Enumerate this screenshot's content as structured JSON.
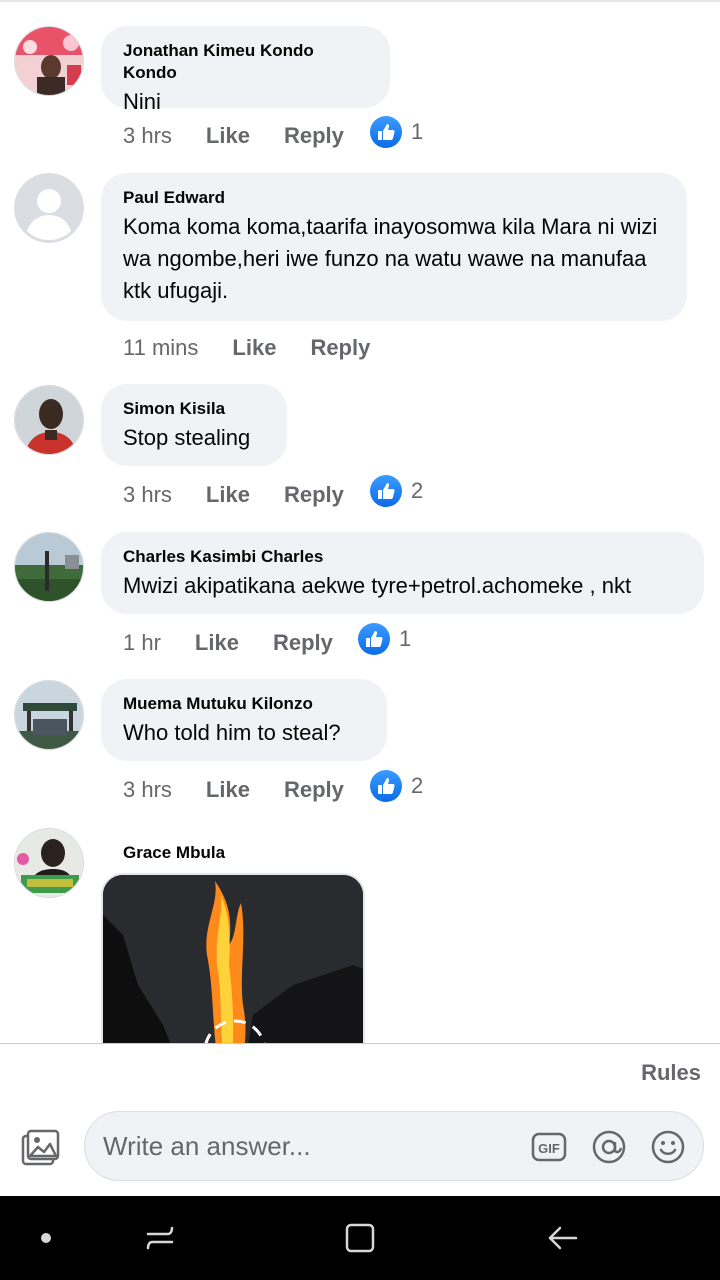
{
  "comments": [
    {
      "author": "Jonathan Kimeu Kondo Kondo",
      "text": "Nini",
      "time": "3 hrs",
      "like_label": "Like",
      "reply_label": "Reply",
      "reaction_count": "1",
      "avatar": "profile-photo-colorful"
    },
    {
      "author": "Paul Edward",
      "text": "Koma koma koma,taarifa inayosomwa kila Mara ni wizi wa ngombe,heri iwe funzo na watu wawe na manufaa ktk ufugaji.",
      "time": "11 mins",
      "like_label": "Like",
      "reply_label": "Reply",
      "reaction_count": "",
      "avatar": "default-user-icon"
    },
    {
      "author": "Simon Kisila",
      "text": "Stop stealing",
      "time": "3 hrs",
      "like_label": "Like",
      "reply_label": "Reply",
      "reaction_count": "2",
      "avatar": "profile-photo-man-red-shirt"
    },
    {
      "author": "Charles Kasimbi Charles",
      "text": "Mwizi akipatikana aekwe tyre+petrol.achomeke , nkt",
      "time": "1 hr",
      "like_label": "Like",
      "reply_label": "Reply",
      "reaction_count": "1",
      "avatar": "profile-photo-outdoor-green"
    },
    {
      "author": "Muema Mutuku Kilonzo",
      "text": "Who told him to steal?",
      "time": "3 hrs",
      "like_label": "Like",
      "reply_label": "Reply",
      "reaction_count": "2",
      "avatar": "profile-photo-structure"
    },
    {
      "author": "Grace Mbula",
      "text": "",
      "time": "",
      "like_label": "",
      "reply_label": "",
      "reaction_count": "",
      "avatar": "profile-photo-woman-flowers",
      "attachment": "photo-fire-at-night"
    }
  ],
  "composer": {
    "rules_label": "Rules",
    "placeholder": "Write an answer...",
    "icons": [
      "photo-icon",
      "gif-icon",
      "mention-icon",
      "emoji-icon"
    ]
  },
  "system_nav": {
    "icons": [
      "home-dot-icon",
      "recents-icon",
      "overview-icon",
      "back-icon"
    ]
  },
  "colors": {
    "bubble_bg": "#f0f2f5",
    "muted_text": "#65676b",
    "like_blue": "#1877f2",
    "nav_bar": "#000000"
  }
}
